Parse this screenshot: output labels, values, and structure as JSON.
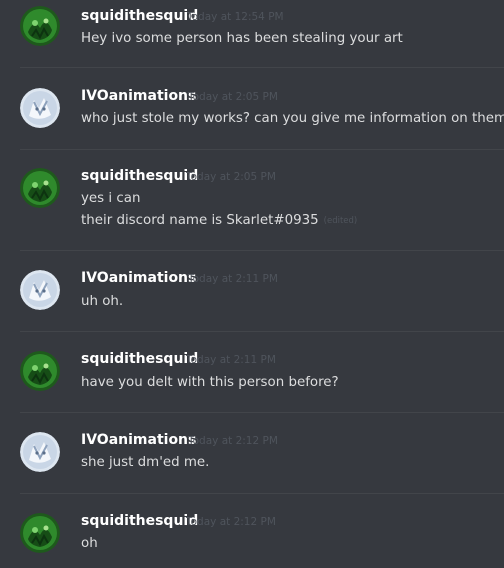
{
  "messages": [
    {
      "author": "squidithesquid",
      "time": "Today at 12:54 PM",
      "lines": [
        "Hey ivo some person has been stealing your art"
      ]
    },
    {
      "author": "IVOanimations",
      "time": "Today at 2:05 PM",
      "lines": [
        "who just stole my works? can you give me information on them?"
      ]
    },
    {
      "author": "squidithesquid",
      "time": "Today at 2:05 PM",
      "lines": [
        "yes i can",
        "their discord name is Skarlet#0935"
      ],
      "edited_label": "(edited)"
    },
    {
      "author": "IVOanimations",
      "time": "Today at 2:11 PM",
      "lines": [
        "uh oh."
      ]
    },
    {
      "author": "squidithesquid",
      "time": "Today at 2:11 PM",
      "lines": [
        "have you delt with this person before?"
      ]
    },
    {
      "author": "IVOanimations",
      "time": "Today at 2:12 PM",
      "lines": [
        "she just dm'ed me."
      ]
    },
    {
      "author": "squidithesquid",
      "time": "Today at 2:12 PM",
      "lines": [
        "oh"
      ]
    }
  ],
  "avatars": {
    "squidithesquid": {
      "icon": "green-squid-avatar-icon",
      "color": "#2f8a2c"
    },
    "IVOanimations": {
      "icon": "white-wolf-avatar-icon",
      "color": "#c9d6e6"
    }
  }
}
